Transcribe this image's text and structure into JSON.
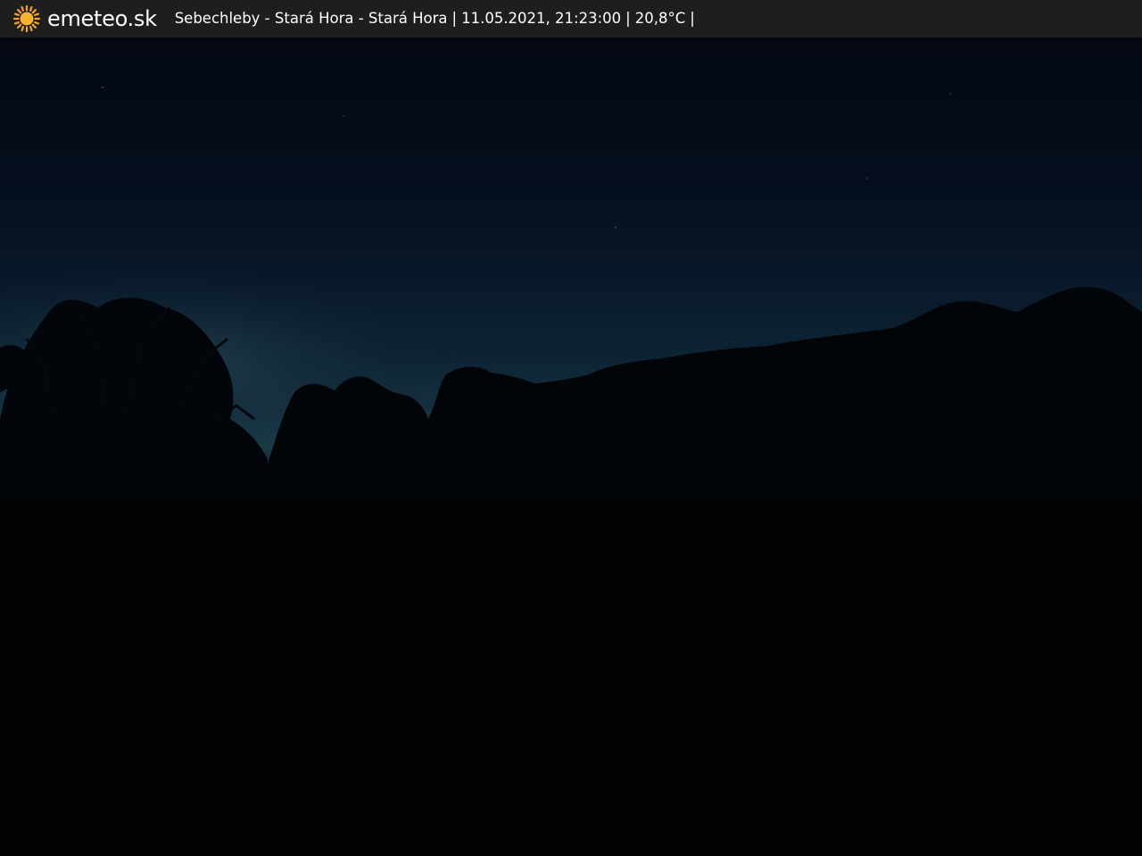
{
  "brand": {
    "name": "emeteo.sk",
    "icon": "sun-icon",
    "icon_color": "#f5a623"
  },
  "caption": {
    "location": "Sebechleby - Stará Hora - Stará Hora",
    "datetime": "11.05.2021, 21:23:00",
    "temperature": "20,8°C",
    "separator": "|"
  },
  "colors": {
    "bar_background": "#1e1e1e",
    "sky_top": "#050b16",
    "sky_horizon": "#1a3a48",
    "ground": "#030405"
  }
}
